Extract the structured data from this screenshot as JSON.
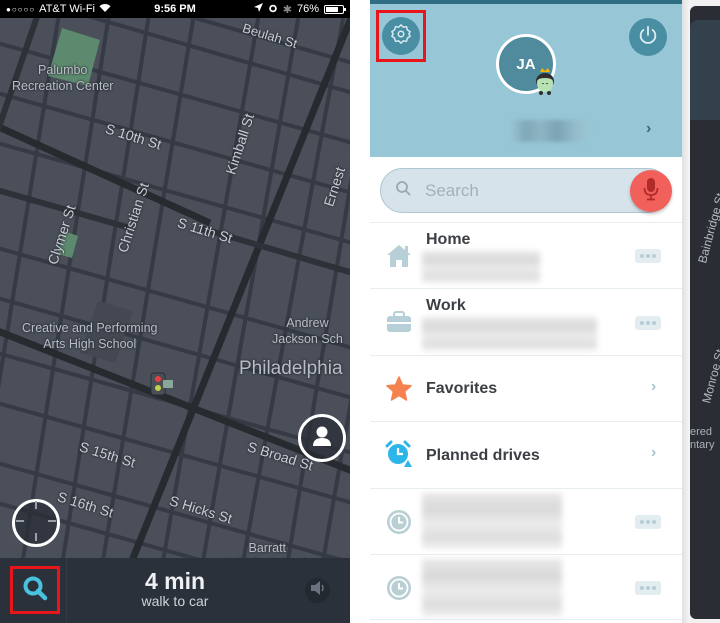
{
  "status_bar": {
    "carrier": "AT&T Wi-Fi",
    "signal_icon": "signal-dots-icon",
    "wifi_icon": "wifi-icon",
    "time": "9:56 PM",
    "location_icon": "location-arrow-icon",
    "alarm_icon": "alarm-icon",
    "bluetooth_icon": "bluetooth-icon",
    "battery_percent": "76%",
    "battery_level": 0.76
  },
  "map": {
    "street_labels": {
      "beulah": "Beulah St",
      "s10th": "S 10th St",
      "kimball": "Kimball St",
      "ernest": "Ernest",
      "christian": "Christian St",
      "s11th": "S 11th St",
      "clymer": "Clymer St",
      "s15th": "S 15th St",
      "s16th": "S 16th St",
      "shicks": "S Hicks St",
      "sbroad": "S Broad St"
    },
    "poi_labels": {
      "palumbo": "Palumbo\nRecreation Center",
      "creative": "Creative and Performing\nArts High School",
      "andrew": "Andrew\nJackson Sch",
      "barratt": "Barratt\nMiddle School"
    },
    "city_label": "Philadelphia",
    "colors": {
      "background": "#4a4f5a",
      "street": "#353a44",
      "major_road": "#252b2e",
      "park": "#5d8a6e"
    }
  },
  "bottom_bar": {
    "search_icon": "search-icon",
    "eta_value": "4 min",
    "eta_label": "walk to car",
    "sound_icon": "speaker-icon"
  },
  "menu": {
    "profile": {
      "initials": "JA",
      "settings_icon": "gear-icon",
      "power_icon": "power-icon",
      "mood_icon": "waze-character-icon"
    },
    "search": {
      "placeholder": "Search",
      "mic_icon": "microphone-icon"
    },
    "items": [
      {
        "title": "Home",
        "icon": "home-icon",
        "action": "more"
      },
      {
        "title": "Work",
        "icon": "briefcase-icon",
        "action": "more"
      },
      {
        "title": "Favorites",
        "icon": "star-icon",
        "action": "chevron"
      },
      {
        "title": "Planned drives",
        "icon": "alarm-clock-icon",
        "action": "chevron"
      },
      {
        "title": "",
        "icon": "history-clock-icon",
        "action": "more"
      },
      {
        "title": "",
        "icon": "history-clock-icon",
        "action": "more"
      }
    ],
    "colors": {
      "profile_bg": "#97c7d6",
      "button_bg": "#4a8ea3",
      "mic": "#f2605c",
      "favorites_star": "#f5814f",
      "planned_drives": "#2bb5e8",
      "highlight_box": "#e8151b"
    }
  },
  "background_screen": {
    "street_labels": [
      "Bainbridge St",
      "Monroe St"
    ],
    "partial_text": [
      "ered",
      "ntary"
    ]
  }
}
